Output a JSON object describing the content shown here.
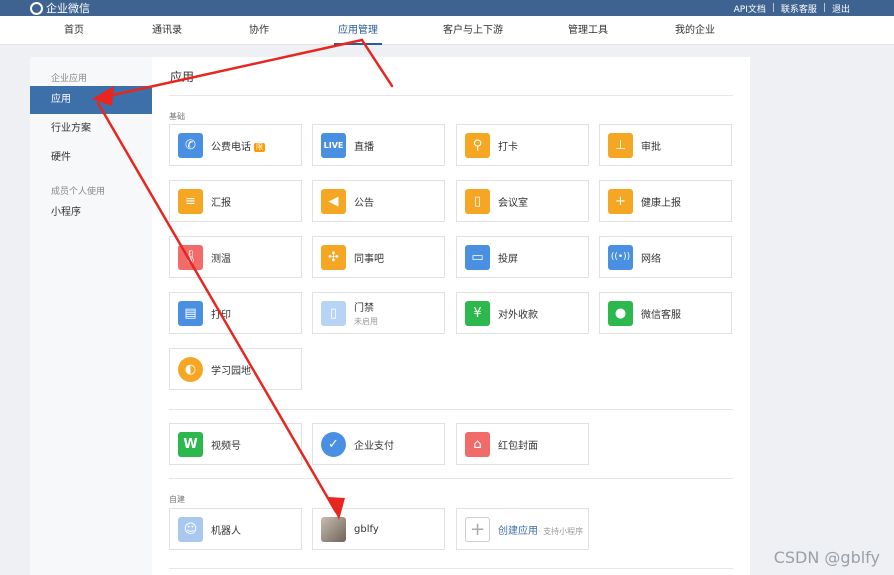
{
  "brand": "企业微信",
  "top_links": [
    "API文档",
    "联系客服",
    "退出"
  ],
  "nav": [
    {
      "label": "首页",
      "active": false
    },
    {
      "label": "通讯录",
      "active": false
    },
    {
      "label": "协作",
      "active": false
    },
    {
      "label": "应用管理",
      "active": true
    },
    {
      "label": "客户与上下游",
      "active": false
    },
    {
      "label": "管理工具",
      "active": false
    },
    {
      "label": "我的企业",
      "active": false
    }
  ],
  "sidebar": {
    "head1": "企业应用",
    "items": [
      "应用",
      "行业方案",
      "硬件"
    ],
    "head2": "成员个人使用",
    "item_mini": "小程序"
  },
  "main": {
    "title": "应用",
    "sec_basic": "基础",
    "sec_custom": "自建"
  },
  "apps": [
    {
      "name": "公费电话",
      "icon": "phone-icon",
      "color": "#4a90e2",
      "badge": "限"
    },
    {
      "name": "直播",
      "icon": "live-icon",
      "color": "#4a90e2"
    },
    {
      "name": "打卡",
      "icon": "location-pin-icon",
      "color": "#f5a623"
    },
    {
      "name": "审批",
      "icon": "stamp-icon",
      "color": "#f5a623"
    },
    {
      "name": "汇报",
      "icon": "report-icon",
      "color": "#f5a623"
    },
    {
      "name": "公告",
      "icon": "megaphone-icon",
      "color": "#f5a623"
    },
    {
      "name": "会议室",
      "icon": "door-icon",
      "color": "#f5a623"
    },
    {
      "name": "健康上报",
      "icon": "clipboard-plus-icon",
      "color": "#f5a623"
    },
    {
      "name": "测温",
      "icon": "thermometer-icon",
      "color": "#f26b6b"
    },
    {
      "name": "同事吧",
      "icon": "share-nodes-icon",
      "color": "#f5a623"
    },
    {
      "name": "投屏",
      "icon": "screen-cast-icon",
      "color": "#4a90e2"
    },
    {
      "name": "网络",
      "icon": "router-icon",
      "color": "#4a90e2"
    },
    {
      "name": "打印",
      "icon": "printer-icon",
      "color": "#4a90e2"
    },
    {
      "name": "门禁",
      "sub": "未启用",
      "icon": "access-door-icon",
      "color": "#b8d4f5"
    },
    {
      "name": "对外收款",
      "icon": "yen-icon",
      "color": "#2db84d"
    },
    {
      "name": "微信客服",
      "icon": "chat-bubble-icon",
      "color": "#2db84d"
    },
    {
      "name": "学习园地",
      "icon": "planet-icon",
      "color": "#f5a623"
    },
    {
      "name": "视频号",
      "icon": "channels-icon",
      "color": "#2db84d"
    },
    {
      "name": "企业支付",
      "icon": "pay-icon",
      "color": "#4a90e2"
    },
    {
      "name": "红包封面",
      "icon": "red-envelope-icon",
      "color": "#f26b6b"
    },
    {
      "name": "机器人",
      "icon": "robot-icon",
      "color": "#a8c8f0"
    },
    {
      "name": "gblfy",
      "icon": "user-photo-icon",
      "color": "#9c8f84"
    },
    {
      "name": "创建应用",
      "sub_inline": "· 支持小程序",
      "icon": "plus-icon",
      "color": "#ffffff"
    }
  ],
  "watermark": "CSDN @gblfy"
}
